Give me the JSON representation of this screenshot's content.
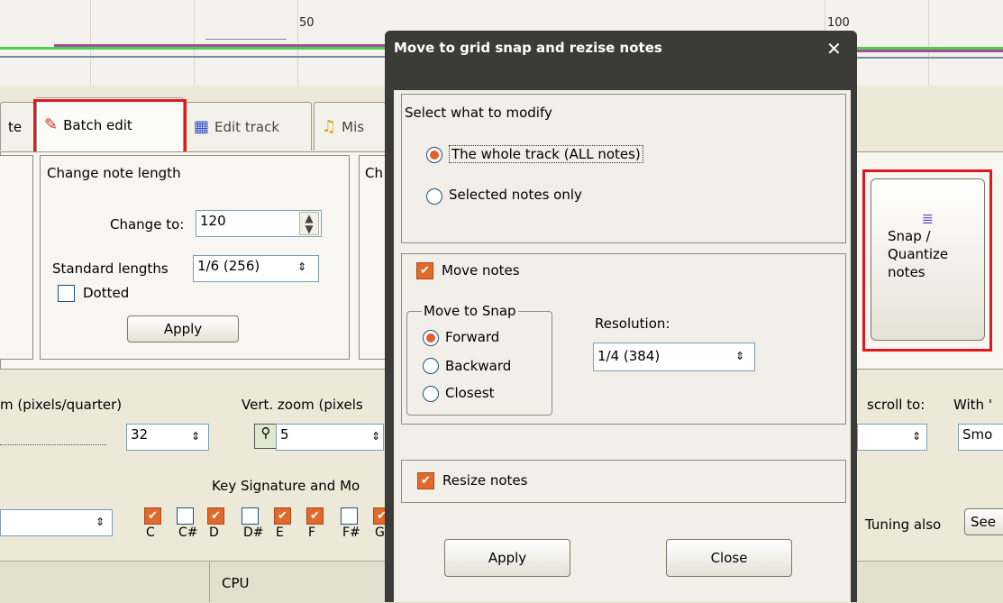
{
  "timeline": {
    "bar_labels": [
      "50",
      "100"
    ]
  },
  "tabs": [
    {
      "label": "te"
    },
    {
      "label": "Batch edit"
    },
    {
      "label": "Edit track"
    },
    {
      "label": "Mis"
    }
  ],
  "change_length": {
    "title": "Change note length",
    "change_to_label": "Change to:",
    "change_to_value": "120",
    "standard_lengths_label": "Standard lengths",
    "standard_lengths_value": "1/6  (256)",
    "dotted_label": "Dotted",
    "apply_label": "Apply"
  },
  "other_group_title": "Ch",
  "snap_button": {
    "label_line1": "Snap /",
    "label_line2": "Quantize",
    "label_line3": "notes"
  },
  "zoom_row": {
    "h_zoom_label": "m (pixels/quarter)",
    "h_zoom_value": "32",
    "v_zoom_label": "Vert. zoom (pixels",
    "v_zoom_value": "5",
    "scroll_label": "scroll to:",
    "with_label": "With '",
    "smooth_value": "Smo"
  },
  "key_row": {
    "title": "Key Signature and Mo",
    "notes": [
      {
        "name": "C",
        "checked": true
      },
      {
        "name": "C#",
        "checked": false
      },
      {
        "name": "D",
        "checked": true
      },
      {
        "name": "D#",
        "checked": false
      },
      {
        "name": "E",
        "checked": true
      },
      {
        "name": "F",
        "checked": true
      },
      {
        "name": "F#",
        "checked": false
      },
      {
        "name": "G",
        "checked": true
      }
    ],
    "tuning_label": "Tuning also",
    "see_label": "See"
  },
  "status": {
    "cpu_label": "CPU"
  },
  "dialog": {
    "title": "Move to grid snap and rezise notes",
    "close_glyph": "✕",
    "select_title": "Select what to modify",
    "opt_whole": "The whole track (ALL notes)",
    "opt_selected": "Selected notes only",
    "move_notes_label": "Move notes",
    "move_to_snap_title": "Move to Snap",
    "forward": "Forward",
    "backward": "Backward",
    "closest": "Closest",
    "resolution_label": "Resolution:",
    "resolution_value": "1/4  (384)",
    "resize_label": "Resize notes",
    "apply_label": "Apply",
    "close_label": "Close"
  },
  "colors": {
    "accent": "#e0602a",
    "highlight": "#e0191e",
    "title_bar": "#3b3c38"
  }
}
